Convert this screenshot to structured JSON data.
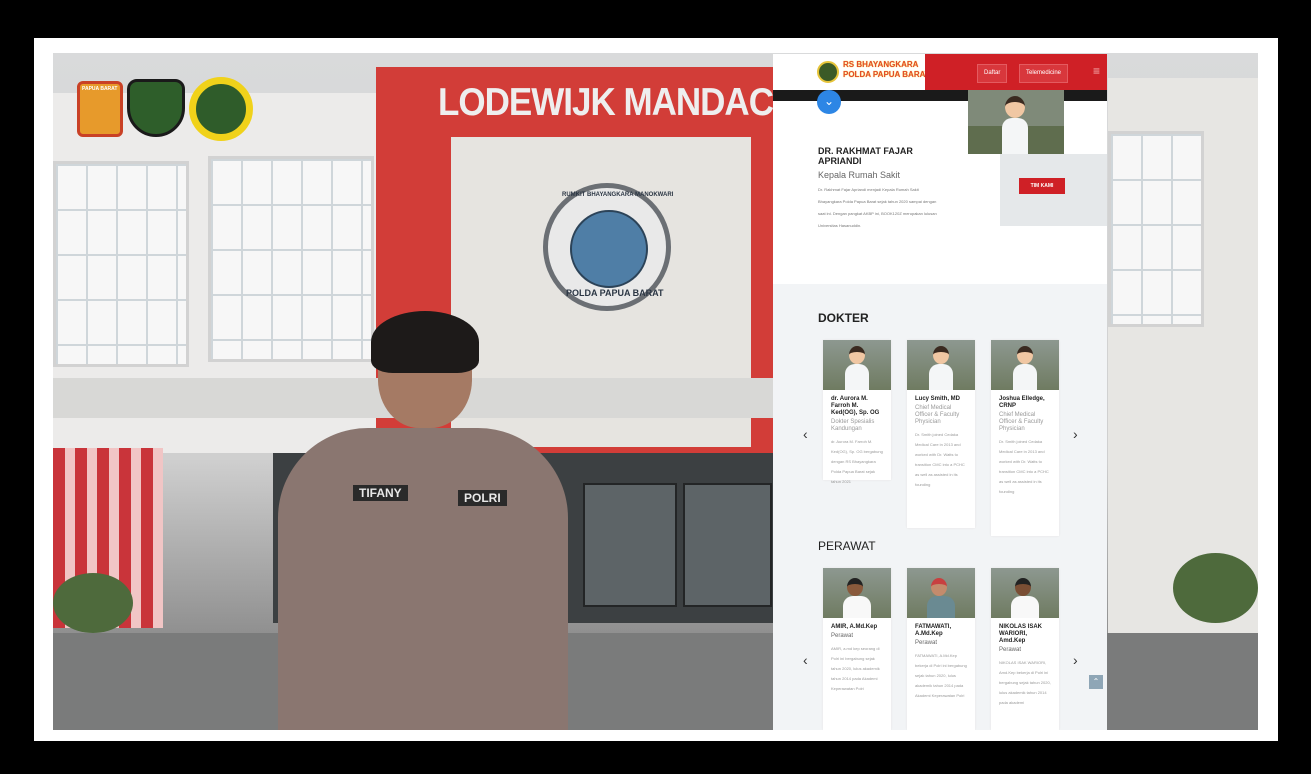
{
  "building": {
    "title": "LODEWIJK MANDACAN",
    "seal_top": "RUMKIT BHAYANGKARA MANOKWARI",
    "seal_bottom": "POLDA PAPUA BARAT"
  },
  "uniform": {
    "name_tag": "TIFANY",
    "unit_tag": "POLRI"
  },
  "logos": {
    "left_label": "PAPUA BARAT"
  },
  "site": {
    "brand_line1": "RS BHAYANGKARA",
    "brand_line2": "POLDA PAPUA BARAT",
    "menu_icon": "≡",
    "nav": {
      "daftar": "Daftar",
      "telemedicine": "Telemedicine"
    },
    "hero": {
      "name": "DR. RAKHMAT FAJAR APRIANDI",
      "role": "Kepala Rumah Sakit",
      "desc": "Dr. Rakhmat Fajar Apriandi menjadi Kepala Rumah Sakit Bhayangkara Polda Papua Barat sejak tahun 2020 sampai dengan saat ini. Dengan pangkat AKBP ini, BOOK120Z merupakan lulusan Universitas Hasanuddin.",
      "team_button": "TIM KAMI"
    },
    "doctors": {
      "title": "DOKTER",
      "cards": [
        {
          "name": "dr. Aurora M. Farroh M. Ked(OG), Sp. OG",
          "role": "Dokter Spesialis Kandungan",
          "desc": "dr. Aurora M. Farroh M. Ked(OG), Sp. OG bergabung dengan RS Bhayangkara Polda Papua Barat sejak tahun 2021"
        },
        {
          "name": "Lucy Smith, MD",
          "role": "Chief Medical Officer & Faculty Physician",
          "desc": "Dr. Smith joined Cedaka Medical Care in 2013 and worked with Dr. Watts to transition CMC into a PCHC as well as assisted in its founding"
        },
        {
          "name": "Joshua Elledge, CRNP",
          "role": "Chief Medical Officer & Faculty Physician",
          "desc": "Dr. Smith joined Cedaka Medical Care in 2013 and worked with Dr. Watts to transition CMC into a PCHC as well as assisted in its founding"
        }
      ]
    },
    "nurses": {
      "title": "PERAWAT",
      "cards": [
        {
          "name": "AMIR, A.Md.Kep",
          "role": "Perawat",
          "desc": "AMIR, a.md kep seorang di Polri ini bergabung sejak tahun 2020, lulus akademik tahun 2014 pada Akademi Keperawatan Polri"
        },
        {
          "name": "FATMAWATI, A.Md.Kep",
          "role": "Perawat",
          "desc": "FATMAWATI, A.Md.Kep bekerja di Polri ini bergabung sejak tahun 2020, lulus akademik tahun 2014 pada Akademi Keperawatan Polri"
        },
        {
          "name": "NIKOLAS ISAK WARIORI, Amd.Kep",
          "role": "Perawat",
          "desc": "NIKOLAS ISAK WARIORI, Amd.Kep bekerja di Polri ini bergabung sejak tahun 2020, lulus akademik tahun 2014 pada akademi"
        }
      ]
    },
    "arrows": {
      "prev": "‹",
      "next": "›"
    },
    "scroll_top": "⌃"
  }
}
